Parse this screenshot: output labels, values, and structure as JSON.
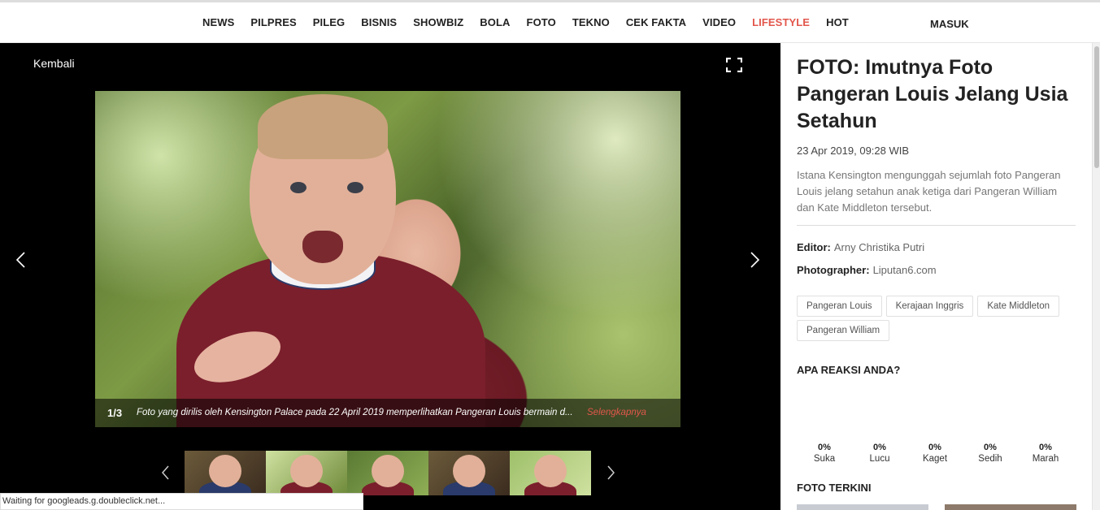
{
  "nav": {
    "items": [
      "NEWS",
      "PILPRES",
      "PILEG",
      "BISNIS",
      "SHOWBIZ",
      "BOLA",
      "FOTO",
      "TEKNO",
      "CEK FAKTA",
      "VIDEO",
      "LIFESTYLE",
      "HOT"
    ],
    "active": "LIFESTYLE",
    "login": "MASUK"
  },
  "viewer": {
    "back": "Kembali",
    "counter": "1/3",
    "caption": "Foto yang dirilis oleh Kensington Palace pada 22 April 2019 memperlihatkan Pangeran Louis bermain d...",
    "more": "Selengkapnya"
  },
  "article": {
    "title": "FOTO: Imutnya Foto Pangeran Louis Jelang Usia Setahun",
    "date": "23 Apr 2019, 09:28 WIB",
    "summary": "Istana Kensington mengunggah sejumlah foto Pangeran Louis jelang setahun anak ketiga dari Pangeran William dan Kate Middleton tersebut.",
    "editor_label": "Editor:",
    "editor": "Arny Christika Putri",
    "photographer_label": "Photographer:",
    "photographer": "Liputan6.com",
    "tags": [
      "Pangeran Louis",
      "Kerajaan Inggris",
      "Kate Middleton",
      "Pangeran William"
    ]
  },
  "reactions": {
    "heading": "APA REAKSI ANDA?",
    "items": [
      {
        "pct": "0%",
        "label": "Suka"
      },
      {
        "pct": "0%",
        "label": "Lucu"
      },
      {
        "pct": "0%",
        "label": "Kaget"
      },
      {
        "pct": "0%",
        "label": "Sedih"
      },
      {
        "pct": "0%",
        "label": "Marah"
      }
    ]
  },
  "latest": {
    "heading": "FOTO TERKINI"
  },
  "status": "Waiting for googleads.g.doubleclick.net...",
  "colors": {
    "accent": "#e2574c",
    "viewer_bg": "#000000"
  }
}
